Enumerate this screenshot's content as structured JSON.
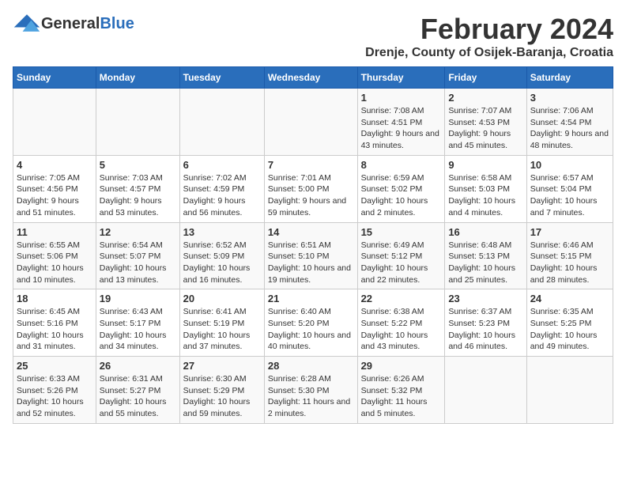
{
  "header": {
    "logo_general": "General",
    "logo_blue": "Blue",
    "title": "February 2024",
    "location": "Drenje, County of Osijek-Baranja, Croatia"
  },
  "days_of_week": [
    "Sunday",
    "Monday",
    "Tuesday",
    "Wednesday",
    "Thursday",
    "Friday",
    "Saturday"
  ],
  "weeks": [
    {
      "days": [
        {
          "num": "",
          "info": ""
        },
        {
          "num": "",
          "info": ""
        },
        {
          "num": "",
          "info": ""
        },
        {
          "num": "",
          "info": ""
        },
        {
          "num": "1",
          "info": "Sunrise: 7:08 AM\nSunset: 4:51 PM\nDaylight: 9 hours and 43 minutes."
        },
        {
          "num": "2",
          "info": "Sunrise: 7:07 AM\nSunset: 4:53 PM\nDaylight: 9 hours and 45 minutes."
        },
        {
          "num": "3",
          "info": "Sunrise: 7:06 AM\nSunset: 4:54 PM\nDaylight: 9 hours and 48 minutes."
        }
      ]
    },
    {
      "days": [
        {
          "num": "4",
          "info": "Sunrise: 7:05 AM\nSunset: 4:56 PM\nDaylight: 9 hours and 51 minutes."
        },
        {
          "num": "5",
          "info": "Sunrise: 7:03 AM\nSunset: 4:57 PM\nDaylight: 9 hours and 53 minutes."
        },
        {
          "num": "6",
          "info": "Sunrise: 7:02 AM\nSunset: 4:59 PM\nDaylight: 9 hours and 56 minutes."
        },
        {
          "num": "7",
          "info": "Sunrise: 7:01 AM\nSunset: 5:00 PM\nDaylight: 9 hours and 59 minutes."
        },
        {
          "num": "8",
          "info": "Sunrise: 6:59 AM\nSunset: 5:02 PM\nDaylight: 10 hours and 2 minutes."
        },
        {
          "num": "9",
          "info": "Sunrise: 6:58 AM\nSunset: 5:03 PM\nDaylight: 10 hours and 4 minutes."
        },
        {
          "num": "10",
          "info": "Sunrise: 6:57 AM\nSunset: 5:04 PM\nDaylight: 10 hours and 7 minutes."
        }
      ]
    },
    {
      "days": [
        {
          "num": "11",
          "info": "Sunrise: 6:55 AM\nSunset: 5:06 PM\nDaylight: 10 hours and 10 minutes."
        },
        {
          "num": "12",
          "info": "Sunrise: 6:54 AM\nSunset: 5:07 PM\nDaylight: 10 hours and 13 minutes."
        },
        {
          "num": "13",
          "info": "Sunrise: 6:52 AM\nSunset: 5:09 PM\nDaylight: 10 hours and 16 minutes."
        },
        {
          "num": "14",
          "info": "Sunrise: 6:51 AM\nSunset: 5:10 PM\nDaylight: 10 hours and 19 minutes."
        },
        {
          "num": "15",
          "info": "Sunrise: 6:49 AM\nSunset: 5:12 PM\nDaylight: 10 hours and 22 minutes."
        },
        {
          "num": "16",
          "info": "Sunrise: 6:48 AM\nSunset: 5:13 PM\nDaylight: 10 hours and 25 minutes."
        },
        {
          "num": "17",
          "info": "Sunrise: 6:46 AM\nSunset: 5:15 PM\nDaylight: 10 hours and 28 minutes."
        }
      ]
    },
    {
      "days": [
        {
          "num": "18",
          "info": "Sunrise: 6:45 AM\nSunset: 5:16 PM\nDaylight: 10 hours and 31 minutes."
        },
        {
          "num": "19",
          "info": "Sunrise: 6:43 AM\nSunset: 5:17 PM\nDaylight: 10 hours and 34 minutes."
        },
        {
          "num": "20",
          "info": "Sunrise: 6:41 AM\nSunset: 5:19 PM\nDaylight: 10 hours and 37 minutes."
        },
        {
          "num": "21",
          "info": "Sunrise: 6:40 AM\nSunset: 5:20 PM\nDaylight: 10 hours and 40 minutes."
        },
        {
          "num": "22",
          "info": "Sunrise: 6:38 AM\nSunset: 5:22 PM\nDaylight: 10 hours and 43 minutes."
        },
        {
          "num": "23",
          "info": "Sunrise: 6:37 AM\nSunset: 5:23 PM\nDaylight: 10 hours and 46 minutes."
        },
        {
          "num": "24",
          "info": "Sunrise: 6:35 AM\nSunset: 5:25 PM\nDaylight: 10 hours and 49 minutes."
        }
      ]
    },
    {
      "days": [
        {
          "num": "25",
          "info": "Sunrise: 6:33 AM\nSunset: 5:26 PM\nDaylight: 10 hours and 52 minutes."
        },
        {
          "num": "26",
          "info": "Sunrise: 6:31 AM\nSunset: 5:27 PM\nDaylight: 10 hours and 55 minutes."
        },
        {
          "num": "27",
          "info": "Sunrise: 6:30 AM\nSunset: 5:29 PM\nDaylight: 10 hours and 59 minutes."
        },
        {
          "num": "28",
          "info": "Sunrise: 6:28 AM\nSunset: 5:30 PM\nDaylight: 11 hours and 2 minutes."
        },
        {
          "num": "29",
          "info": "Sunrise: 6:26 AM\nSunset: 5:32 PM\nDaylight: 11 hours and 5 minutes."
        },
        {
          "num": "",
          "info": ""
        },
        {
          "num": "",
          "info": ""
        }
      ]
    }
  ]
}
